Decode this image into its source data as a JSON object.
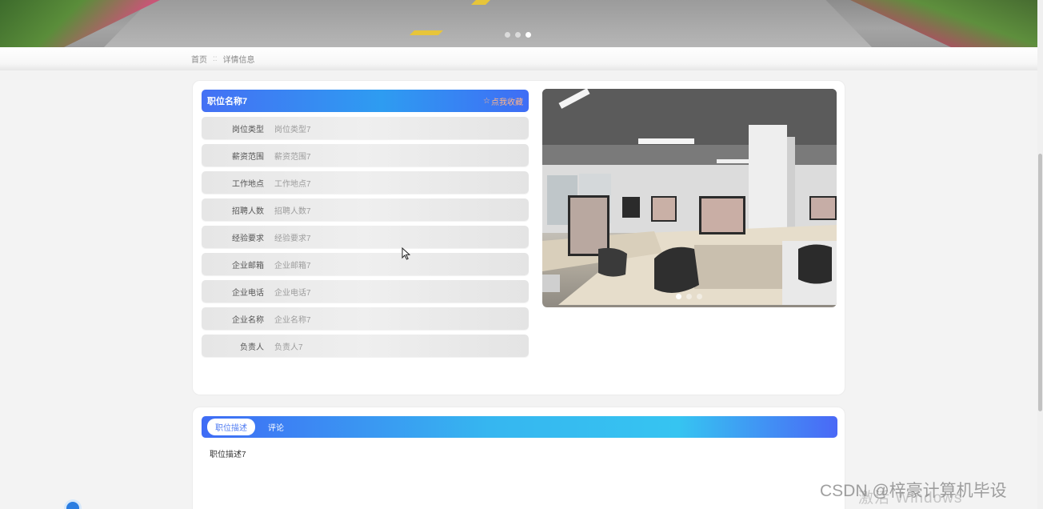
{
  "hero": {
    "carousel_dots": 3,
    "active_dot": 3
  },
  "breadcrumb": {
    "home": "首页",
    "separator": "::",
    "current": "详情信息"
  },
  "job": {
    "title": "职位名称7",
    "favorite_label": "点我收藏",
    "fields": [
      {
        "label": "岗位类型",
        "value": "岗位类型7"
      },
      {
        "label": "薪资范围",
        "value": "薪资范围7"
      },
      {
        "label": "工作地点",
        "value": "工作地点7"
      },
      {
        "label": "招聘人数",
        "value": "招聘人数7"
      },
      {
        "label": "经验要求",
        "value": "经验要求7"
      },
      {
        "label": "企业邮箱",
        "value": "企业邮箱7"
      },
      {
        "label": "企业电话",
        "value": "企业电话7"
      },
      {
        "label": "企业名称",
        "value": "企业名称7"
      },
      {
        "label": "负责人",
        "value": "负责人7"
      }
    ]
  },
  "gallery": {
    "carousel_dots": 3,
    "active_dot": 1
  },
  "tabs": {
    "items": [
      "职位描述",
      "评论"
    ],
    "active": "职位描述",
    "content": "职位描述7"
  },
  "watermark": {
    "windows": "激活 Windows",
    "csdn": "CSDN @梓豪计算机毕设"
  },
  "colors": {
    "accent_blue": "#4470f4",
    "accent_cyan": "#36c4f1",
    "favorite_orange": "#ffb58a"
  }
}
